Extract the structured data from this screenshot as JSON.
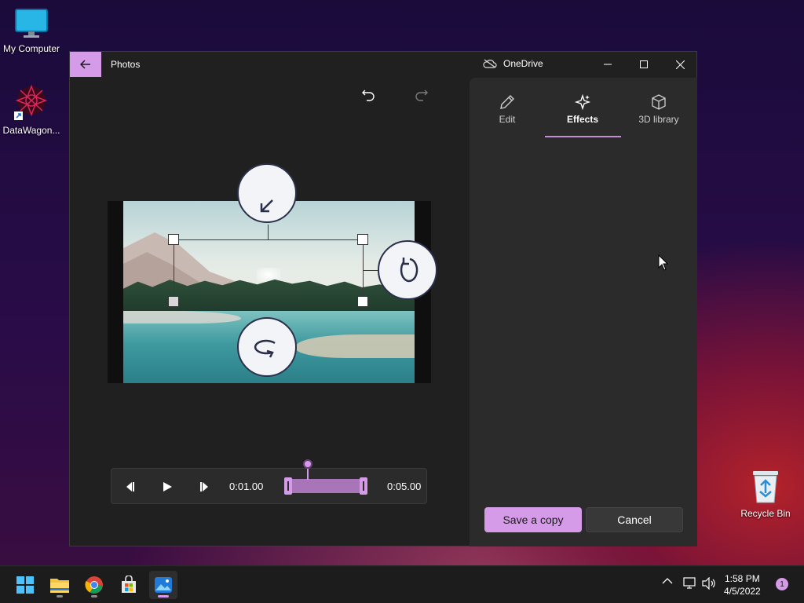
{
  "desktop": {
    "icons": [
      {
        "label": "My Computer",
        "icon": "monitor-icon"
      },
      {
        "label": "DataWagon...",
        "icon": "datawagon-shortcut-icon"
      },
      {
        "label": "Recycle Bin",
        "icon": "recycle-bin-icon"
      }
    ]
  },
  "window": {
    "app_title": "Photos",
    "onedrive_label": "OneDrive",
    "tabs": [
      {
        "label": "Edit",
        "icon": "pencil-icon"
      },
      {
        "label": "Effects",
        "icon": "sparkle-icon",
        "active": true
      },
      {
        "label": "3D library",
        "icon": "cube-icon"
      }
    ],
    "playback": {
      "current_time": "0:01.00",
      "end_time": "0:05.00"
    },
    "buttons": {
      "save_label": "Save a copy",
      "cancel_label": "Cancel"
    }
  },
  "taskbar": {
    "apps": [
      "start-icon",
      "file-explorer-icon",
      "chrome-icon",
      "store-icon",
      "photos-icon"
    ],
    "clock_time": "1:58 PM",
    "clock_date": "4/5/2022",
    "notification_count": "1"
  },
  "colors": {
    "accent": "#d69be8",
    "window_bg": "#202020",
    "panel_bg": "#2b2b2b"
  }
}
